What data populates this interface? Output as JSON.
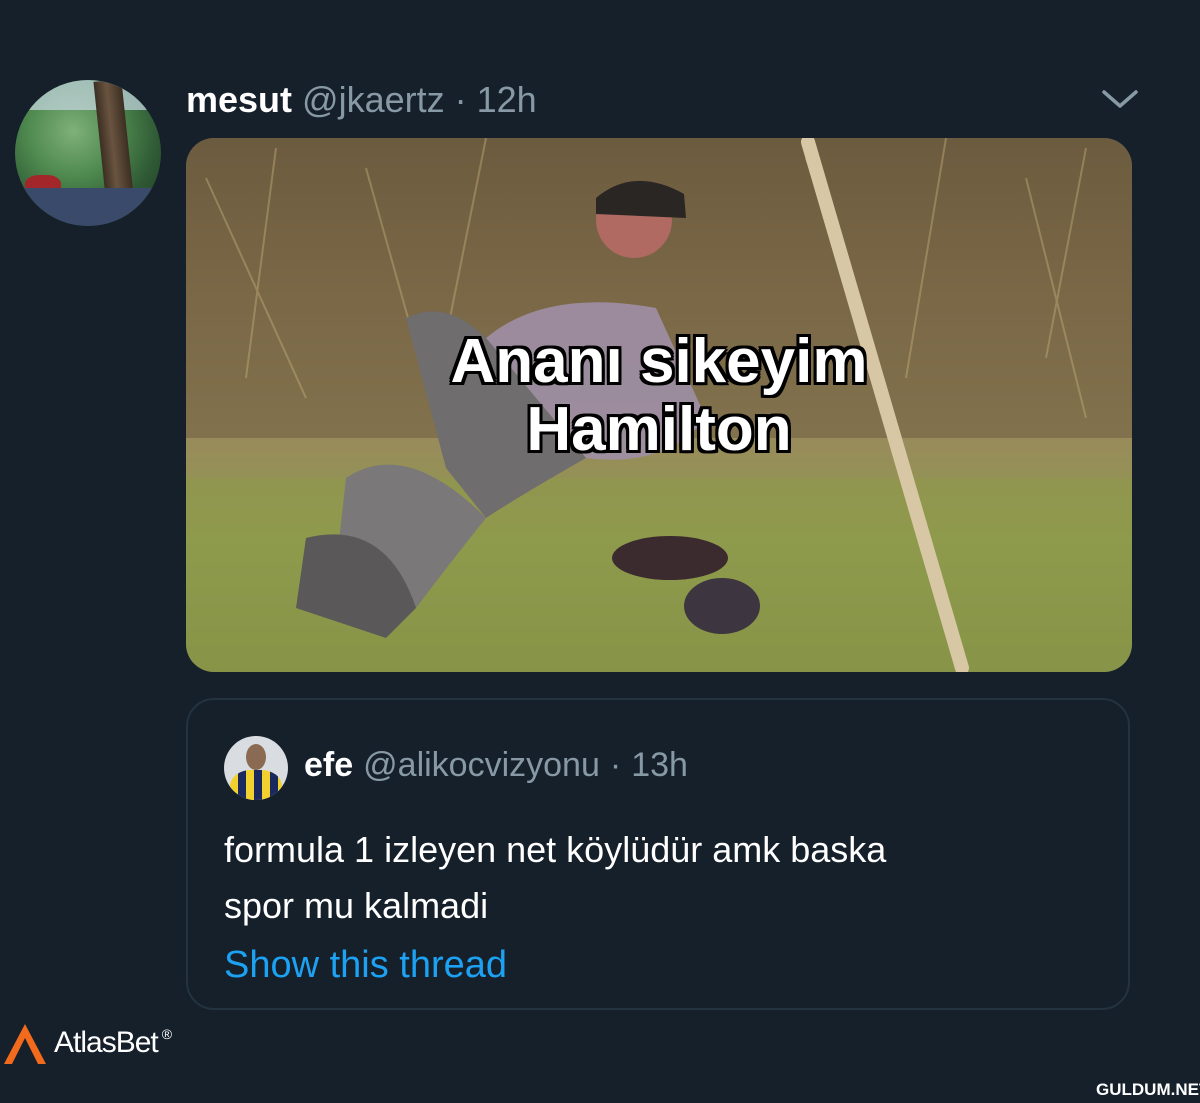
{
  "tweet": {
    "author_name": "mesut",
    "author_handle": "@jkaertz",
    "separator": "·",
    "time": "12h",
    "menu_icon": "chevron-down-icon",
    "media_caption_line1": "Ananı sikeyim",
    "media_caption_line2": "Hamilton"
  },
  "quoted_tweet": {
    "author_name": "efe",
    "author_handle": "@alikocvizyonu",
    "separator": "·",
    "time": "13h",
    "text_line1": "formula 1 izleyen net köylüdür amk baska",
    "text_line2": "spor mu kalmadi",
    "show_thread_label": "Show this thread"
  },
  "overlay": {
    "brand_name": "AtlasBet",
    "brand_mark": "®",
    "watermark": "GULDUM.NET"
  },
  "colors": {
    "background": "#15202b",
    "secondary_text": "#8899a6",
    "link": "#1da1f2",
    "brand_orange": "#f26b1d"
  }
}
